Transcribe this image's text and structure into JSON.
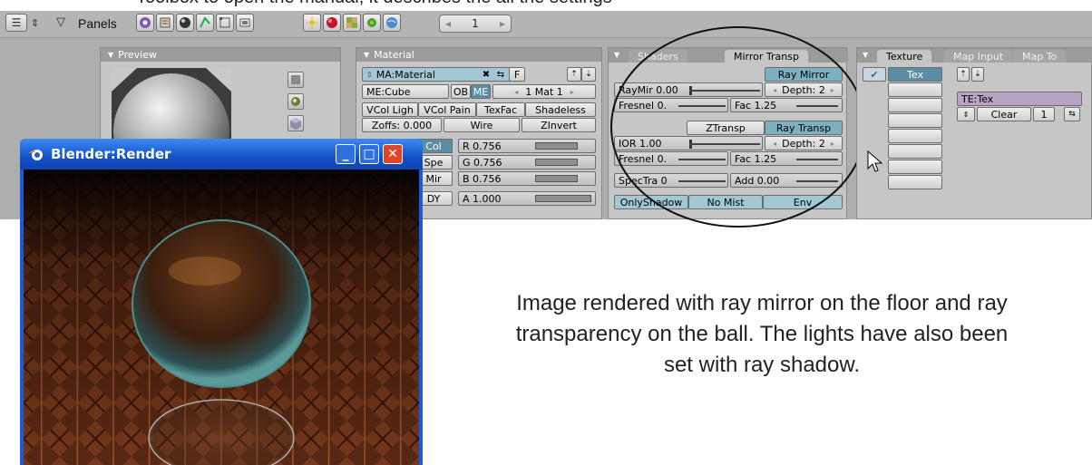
{
  "caption_top": "Toolbox to open the manual, it describes the all the settings",
  "header": {
    "panels_label": "Panels",
    "frame_number": "1"
  },
  "preview_panel": {
    "title": "Preview"
  },
  "material_panel": {
    "title": "Material",
    "ma_name": "MA:Material",
    "f_label": "F",
    "me_name": "ME:Cube",
    "ob_label": "OB",
    "me_label": "ME",
    "mat_count": "1 Mat 1",
    "vcol_light": "VCol Ligh",
    "vcol_paint": "VCol Pain",
    "texface": "TexFac",
    "shadeless": "Shadeless",
    "zoffs": "Zoffs: 0.000",
    "wire": "Wire",
    "zinvert": "ZInvert",
    "col": "Col",
    "spe": "Spe",
    "mir": "Mir",
    "dy": "DY",
    "r": "R 0.756",
    "g": "G 0.756",
    "b": "B 0.756",
    "a": "A 1.000",
    "r_value": 0.756,
    "g_value": 0.756,
    "b_value": 0.756,
    "a_value": 1.0
  },
  "shaders_panel": {
    "tab_shaders": "Shaders",
    "tab_mirror": "Mirror Transp",
    "ray_mirror": "Ray Mirror",
    "raymir": "RayMir 0.00",
    "depth1": "Depth: 2",
    "fresnel1": "Fresnel 0.",
    "fac1": "Fac 1.25",
    "ztransp": "ZTransp",
    "ray_transp": "Ray Transp",
    "ior": "IOR 1.00",
    "depth2": "Depth: 2",
    "fresnel2": "Fresnel 0.",
    "fac2": "Fac 1.25",
    "spectra": "SpecTra 0",
    "add": "Add 0.00",
    "only_shadow": "OnlyShadow",
    "no_mist": "No Mist",
    "env": "Env"
  },
  "texture_panel": {
    "tab_texture": "Texture",
    "tab_map_input": "Map Input",
    "tab_map_to": "Map To",
    "tex": "Tex",
    "te_name": "TE:Tex",
    "clear": "Clear",
    "user_count": "1"
  },
  "render_window": {
    "title": "Blender:Render",
    "minimize": "_",
    "maximize": "□",
    "close": "✕"
  },
  "annotation": {
    "line1": "Image rendered with ray mirror on the floor and ray",
    "line2": "transparency on the ball. The lights have also been",
    "line3": "set with ray shadow."
  },
  "colors": {
    "panel_bg": "#c6c6c6",
    "button_blue": "#7db1c2",
    "window_blue": "#1c5bd5",
    "close_red": "#e0452a"
  }
}
